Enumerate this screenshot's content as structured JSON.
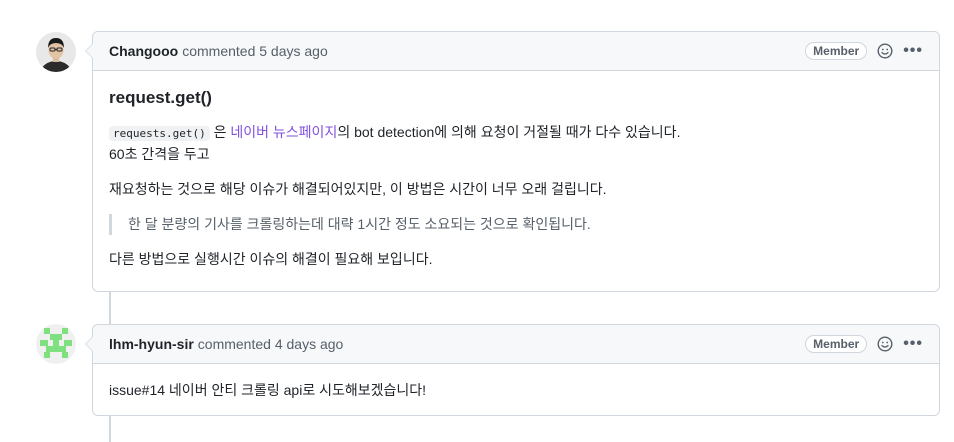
{
  "comments": [
    {
      "author": "Changooo",
      "action": "commented 5 days ago",
      "badge": "Member",
      "heading": "request.get()",
      "code": "requests.get()",
      "text_after_code": " 은 ",
      "link_text": "네이버 뉴스페이지",
      "text_after_link": "의 bot detection에 의해 요청이 거절될 때가 다수 있습니다.",
      "line2": "60초 간격을 두고",
      "para2": "재요청하는 것으로 해당 이슈가 해결되어있지만, 이 방법은 시간이 너무 오래 걸립니다.",
      "quote": "한 달 분량의 기사를 크롤링하는데 대략 1시간 정도 소요되는 것으로 확인됩니다.",
      "para3": "다른 방법으로 실행시간 이슈의 해결이 필요해 보입니다."
    },
    {
      "author": "lhm-hyun-sir",
      "action": "commented 4 days ago",
      "badge": "Member",
      "body": "issue#14 네이버 안티 크롤링 api로 시도해보겠습니다!"
    }
  ],
  "icons": {
    "reaction": "smiley-icon",
    "menu": "kebab-horizontal-icon"
  },
  "colors": {
    "link": "#8250df",
    "border": "#d0d7de",
    "header_bg": "#f6f8fa",
    "identicon": "#7ee07e"
  }
}
